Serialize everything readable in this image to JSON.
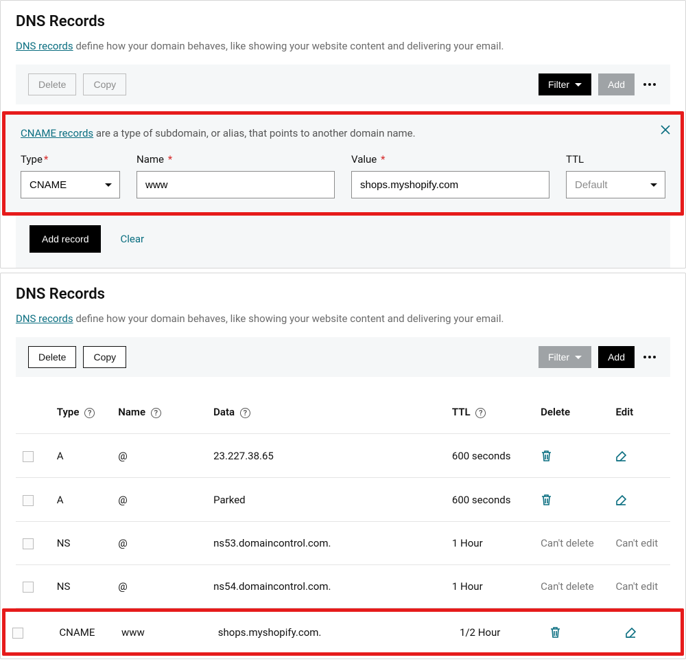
{
  "section1": {
    "title": "DNS Records",
    "desc_link": "DNS records",
    "desc_rest": " define how your domain behaves, like showing your website content and delivering your email.",
    "toolbar": {
      "delete": "Delete",
      "copy": "Copy",
      "filter": "Filter",
      "add": "Add"
    },
    "info_link": "CNAME records",
    "info_rest": " are a type of subdomain, or alias, that points to another domain name.",
    "labels": {
      "type": "Type",
      "name": "Name",
      "value": "Value",
      "ttl": "TTL"
    },
    "values": {
      "type": "CNAME",
      "name": "www",
      "value": "shops.myshopify.com",
      "ttl": "Default"
    },
    "add_record": "Add record",
    "clear": "Clear"
  },
  "section2": {
    "title": "DNS Records",
    "desc_link": "DNS records",
    "desc_rest": " define how your domain behaves, like showing your website content and delivering your email.",
    "toolbar": {
      "delete": "Delete",
      "copy": "Copy",
      "filter": "Filter",
      "add": "Add"
    },
    "headers": {
      "type": "Type",
      "name": "Name",
      "data": "Data",
      "ttl": "TTL",
      "delete": "Delete",
      "edit": "Edit"
    },
    "cant_delete": "Can't delete",
    "cant_edit": "Can't edit",
    "rows": [
      {
        "type": "A",
        "name": "@",
        "data": "23.227.38.65",
        "ttl": "600 seconds",
        "locked": false
      },
      {
        "type": "A",
        "name": "@",
        "data": "Parked",
        "ttl": "600 seconds",
        "locked": false
      },
      {
        "type": "NS",
        "name": "@",
        "data": "ns53.domaincontrol.com.",
        "ttl": "1 Hour",
        "locked": true
      },
      {
        "type": "NS",
        "name": "@",
        "data": "ns54.domaincontrol.com.",
        "ttl": "1 Hour",
        "locked": true
      },
      {
        "type": "CNAME",
        "name": "www",
        "data": "shops.myshopify.com.",
        "ttl": "1/2 Hour",
        "locked": false
      }
    ]
  }
}
